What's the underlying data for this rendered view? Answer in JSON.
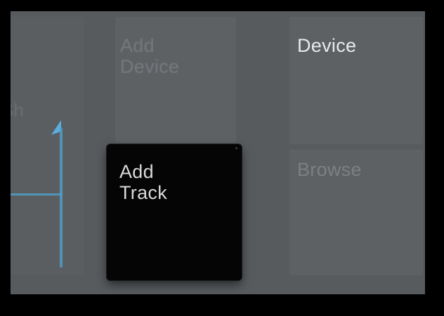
{
  "pads": {
    "left_partial_label": "ow-Sh",
    "add_device": {
      "line1": "Add",
      "line2": "Device"
    },
    "device": {
      "label": "Device"
    },
    "add_track": {
      "line1": "Add",
      "line2": "Track"
    },
    "browse": {
      "label": "Browse"
    }
  },
  "colors": {
    "background": "#000000",
    "surface": "#575b5e",
    "pad": "#5d6164",
    "active_pad": "#050505",
    "accent_blue": "#4f9ec7"
  }
}
